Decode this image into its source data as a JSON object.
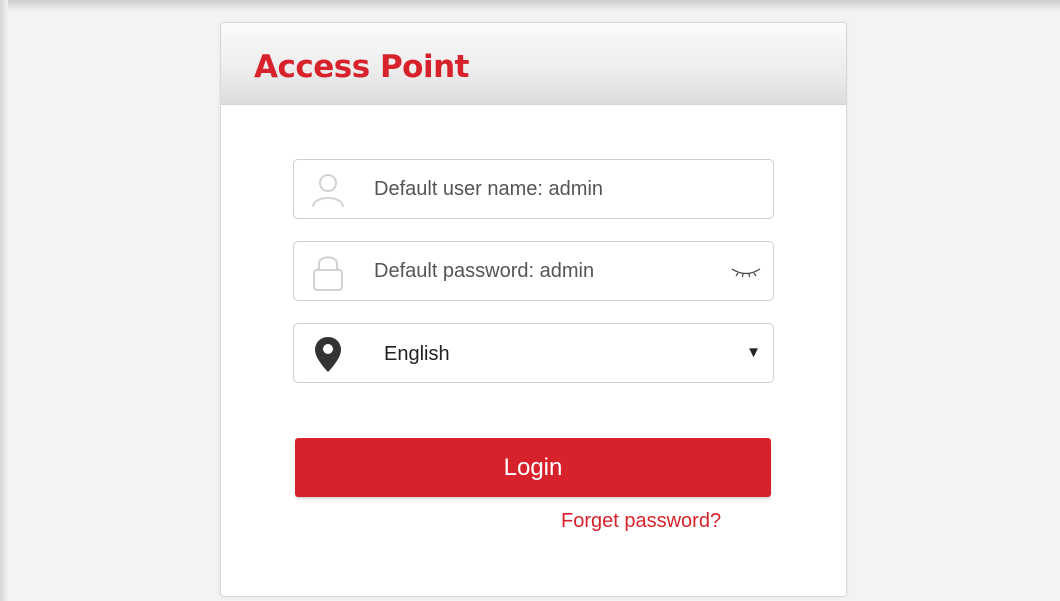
{
  "header": {
    "title": "Access Point"
  },
  "form": {
    "username": {
      "placeholder": "Default user name: admin",
      "icon": "user-icon"
    },
    "password": {
      "placeholder": "Default password: admin",
      "icon": "lock-icon",
      "toggle_icon": "eye-closed-icon"
    },
    "language": {
      "selected": "English",
      "icon": "location-pin-icon"
    },
    "login_label": "Login",
    "forget_label": "Forget password?"
  },
  "colors": {
    "accent": "#d7222b",
    "background": "#f3f3f3"
  }
}
